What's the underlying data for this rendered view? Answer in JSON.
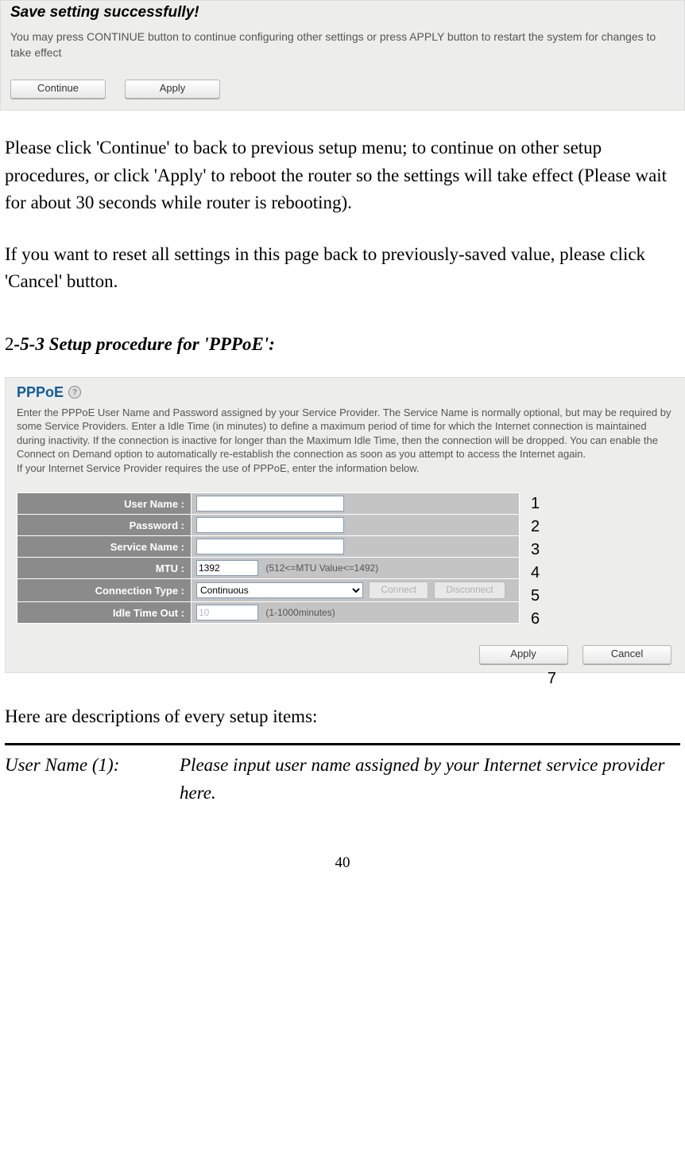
{
  "save_box": {
    "title": "Save setting successfully!",
    "desc": "You may press CONTINUE button to continue configuring other settings or press APPLY button to restart the system for changes to take effect",
    "continue_label": "Continue",
    "apply_label": "Apply"
  },
  "para1": "Please click 'Continue' to back to previous setup menu; to continue on other setup procedures, or click 'Apply' to reboot the router so the settings will take effect (Please wait for about 30 seconds while router is rebooting).",
  "para2": "If you want to reset all settings in this page back to previously-saved value, please click 'Cancel' button.",
  "section_num": "2",
  "section_title": "-5-3 Setup procedure for 'PPPoE':",
  "pppoe": {
    "title": "PPPoE",
    "desc": "Enter the PPPoE User Name and Password assigned by your Service Provider. The Service Name is normally optional, but may be required by some Service Providers. Enter a Idle Time (in minutes) to define a maximum period of time for which the Internet connection is maintained during inactivity. If the connection is inactive for longer than the Maximum Idle Time, then the connection will be dropped. You can enable the Connect on Demand option to automatically re-establish the connection as soon as you attempt to access the Internet again.\nIf your Internet Service Provider requires the use of PPPoE, enter the information below.",
    "rows": {
      "user_name": "User Name :",
      "password": "Password :",
      "service_name": "Service Name :",
      "mtu": "MTU :",
      "mtu_value": "1392",
      "mtu_hint": "(512<=MTU Value<=1492)",
      "conn_type": "Connection Type :",
      "conn_value": "Continuous",
      "connect_label": "Connect",
      "disconnect_label": "Disconnect",
      "idle": "Idle Time Out :",
      "idle_value": "10",
      "idle_hint": "(1-1000minutes)"
    },
    "apply_label": "Apply",
    "cancel_label": "Cancel",
    "numbers": [
      "1",
      "2",
      "3",
      "4",
      "5",
      "6"
    ],
    "seven": "7"
  },
  "setup_intro": "Here are descriptions of every setup items:",
  "desc_item": {
    "label": "User Name (1):",
    "text": "Please input user name assigned by your Internet service provider here."
  },
  "page_number": "40"
}
